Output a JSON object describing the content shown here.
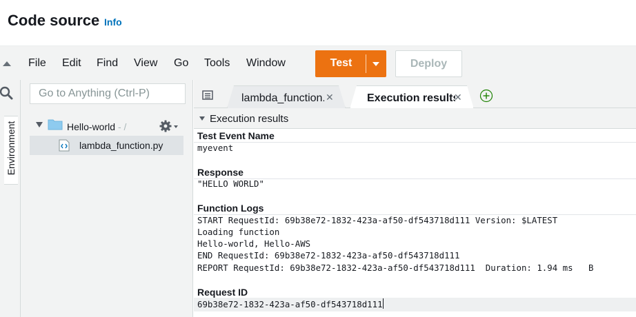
{
  "header": {
    "title": "Code source",
    "info_link": "Info"
  },
  "menu": {
    "items": [
      "File",
      "Edit",
      "Find",
      "View",
      "Go",
      "Tools",
      "Window"
    ],
    "test_label": "Test",
    "deploy_label": "Deploy"
  },
  "rail": {
    "environment_label": "Environment"
  },
  "sidebar": {
    "search_placeholder": "Go to Anything (Ctrl-P)",
    "folder_name": "Hello-world",
    "folder_path": "- /",
    "file_name": "lambda_function.py"
  },
  "tabs": [
    {
      "label": "lambda_function.py",
      "active": false
    },
    {
      "label": "Execution results",
      "active": true
    }
  ],
  "results": {
    "header": "Execution results",
    "test_event_title": "Test Event Name",
    "test_event_value": "myevent",
    "response_title": "Response",
    "response_value": "\"HELLO WORLD\"",
    "logs_title": "Function Logs",
    "logs": [
      "START RequestId: 69b38e72-1832-423a-af50-df543718d111 Version: $LATEST",
      "Loading function",
      "Hello-world, Hello-AWS",
      "END RequestId: 69b38e72-1832-423a-af50-df543718d111",
      "REPORT RequestId: 69b38e72-1832-423a-af50-df543718d111  Duration: 1.94 ms   B"
    ],
    "request_id_title": "Request ID",
    "request_id_value": "69b38e72-1832-423a-af50-df543718d111"
  },
  "colors": {
    "accent": "#ec7211",
    "link": "#0073bb",
    "folder": "#8ecbef"
  }
}
